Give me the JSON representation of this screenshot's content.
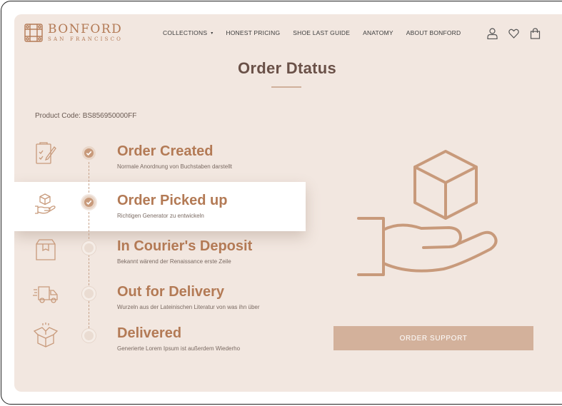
{
  "brand": {
    "name": "BONFORD",
    "tagline": "SAN FRANCISCO"
  },
  "nav": {
    "items": [
      {
        "label": "COLLECTIONS"
      },
      {
        "label": "HONEST PRICING"
      },
      {
        "label": "SHOE LAST GUIDE"
      },
      {
        "label": "ANATOMY"
      },
      {
        "label": "ABOUT BONFORD"
      }
    ],
    "collections_caret": "▾"
  },
  "header_icons": [
    "user-icon",
    "heart-icon",
    "shopping-bag-icon"
  ],
  "page": {
    "title": "Order Dtatus",
    "product_code": "Product Code: BS856950000FF"
  },
  "steps": [
    {
      "title": "Order Created",
      "desc": "Normale Anordnung von Buchstaben darstellt",
      "status": "done",
      "icon": "clipboard-pen-icon"
    },
    {
      "title": "Order Picked up",
      "desc": "Richtigen Generator zu entwickeln",
      "status": "done",
      "icon": "hand-box-icon",
      "highlighted": true
    },
    {
      "title": "In Courier's Deposit",
      "desc": "Bekannt wärend der Renaissance erste Zeile",
      "status": "pending",
      "icon": "package-box-icon"
    },
    {
      "title": "Out for Delivery",
      "desc": "Wurzeln aus der Lateinischen Literatur von was ihn über",
      "status": "pending",
      "icon": "delivery-truck-icon"
    },
    {
      "title": "Delivered",
      "desc": "Generierte Lorem Ipsum ist außerdem Wiederho",
      "status": "pending",
      "icon": "open-box-icon"
    }
  ],
  "illustration": "hand-holding-box-icon",
  "support": {
    "label": "ORDER SUPPORT"
  },
  "colors": {
    "accent": "#b37a55",
    "background": "#f2e7e0",
    "button": "#d3b19b",
    "title": "#6a5148"
  }
}
